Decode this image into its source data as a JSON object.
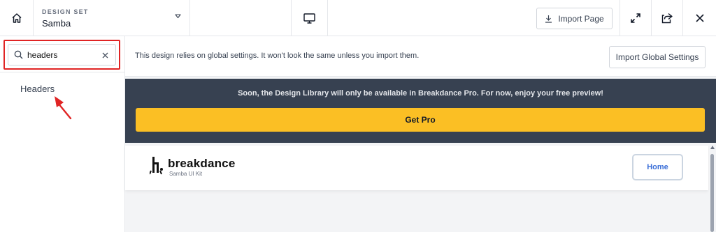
{
  "topbar": {
    "home_icon": "home-icon",
    "design_set_label": "DESIGN SET",
    "design_set_value": "Samba",
    "dropdown_icon": "chevron-down-icon",
    "device_icon": "monitor-icon",
    "import_page_label": "Import Page",
    "import_icon": "download-icon",
    "expand_icon": "expand-icon",
    "share_icon": "share-icon",
    "close_icon": "close-icon"
  },
  "sidebar": {
    "search_value": "headers",
    "search_icon": "search-icon",
    "clear_icon": "close-icon",
    "results": [
      "Headers"
    ]
  },
  "main": {
    "notice_text": "This design relies on global settings. It won't look the same unless you import them.",
    "import_global_label": "Import Global Settings",
    "promo_text": "Soon, the Design Library will only be available in Breakdance Pro. For now, enjoy your free preview!",
    "get_pro_label": "Get Pro",
    "preview": {
      "logo_text": "breakdance",
      "logo_sub": "Samba UI Kit",
      "nav_button": "Home"
    }
  },
  "colors": {
    "highlight_red": "#e02424",
    "promo_bg": "#374151",
    "cta_yellow": "#fbbf24",
    "link_blue": "#3b6fd8"
  }
}
